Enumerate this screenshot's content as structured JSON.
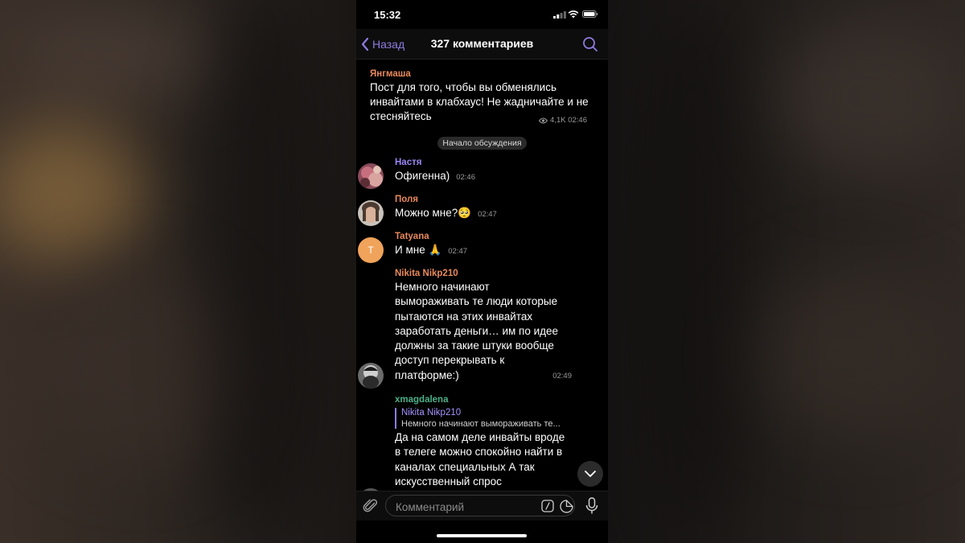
{
  "status": {
    "time": "15:32"
  },
  "header": {
    "back_label": "Назад",
    "title": "327 комментариев"
  },
  "post": {
    "author": "Янгмаша",
    "author_color": "#e8895a",
    "text": "Пост для того, чтобы вы обменялись инвайтами в клабхаус! Не жадничайте и не стесняйтесь",
    "views": "4,1K",
    "time": "02:46"
  },
  "divider_label": "Начало обсуждения",
  "comments": [
    {
      "author": "Настя",
      "color": "#9b87f5",
      "text": "Офигенна)",
      "time": "02:46",
      "avatar": "photo"
    },
    {
      "author": "Поля",
      "color": "#e8895a",
      "text": "Можно мне?🥺",
      "time": "02:47",
      "avatar": "photo"
    },
    {
      "author": "Tatyana",
      "color": "#e8895a",
      "text": "И мне 🙏",
      "time": "02:47",
      "avatar": "T"
    },
    {
      "author": "Nikita Nikp210",
      "color": "#e8895a",
      "text": "Немного начинают вымораживать те люди которые пытаются на этих инвайтах заработать деньги… им по идее должны за такие штуки вообще доступ перекрывать к платформе:)",
      "time": "02:49",
      "avatar": "photo"
    },
    {
      "author": "xmagdalena",
      "color": "#4cb08a",
      "reply_to": {
        "author": "Nikita Nikp210",
        "text": "Немного начинают вымораживать те..."
      },
      "text": "Да на самом деле инвайты вроде в телеге можно спокойно найти в каналах специальных А так искусственный спрос",
      "time": "",
      "avatar": "photo"
    }
  ],
  "input": {
    "placeholder": "Комментарий"
  },
  "colors": {
    "accent": "#8f7be0",
    "background": "#000000",
    "tatyana_avatar": "#f0a35a"
  },
  "icons": [
    "chevron-left-icon",
    "search-icon",
    "eye-icon",
    "chevron-down-icon",
    "paperclip-icon",
    "command-icon",
    "sticker-icon",
    "microphone-icon"
  ]
}
